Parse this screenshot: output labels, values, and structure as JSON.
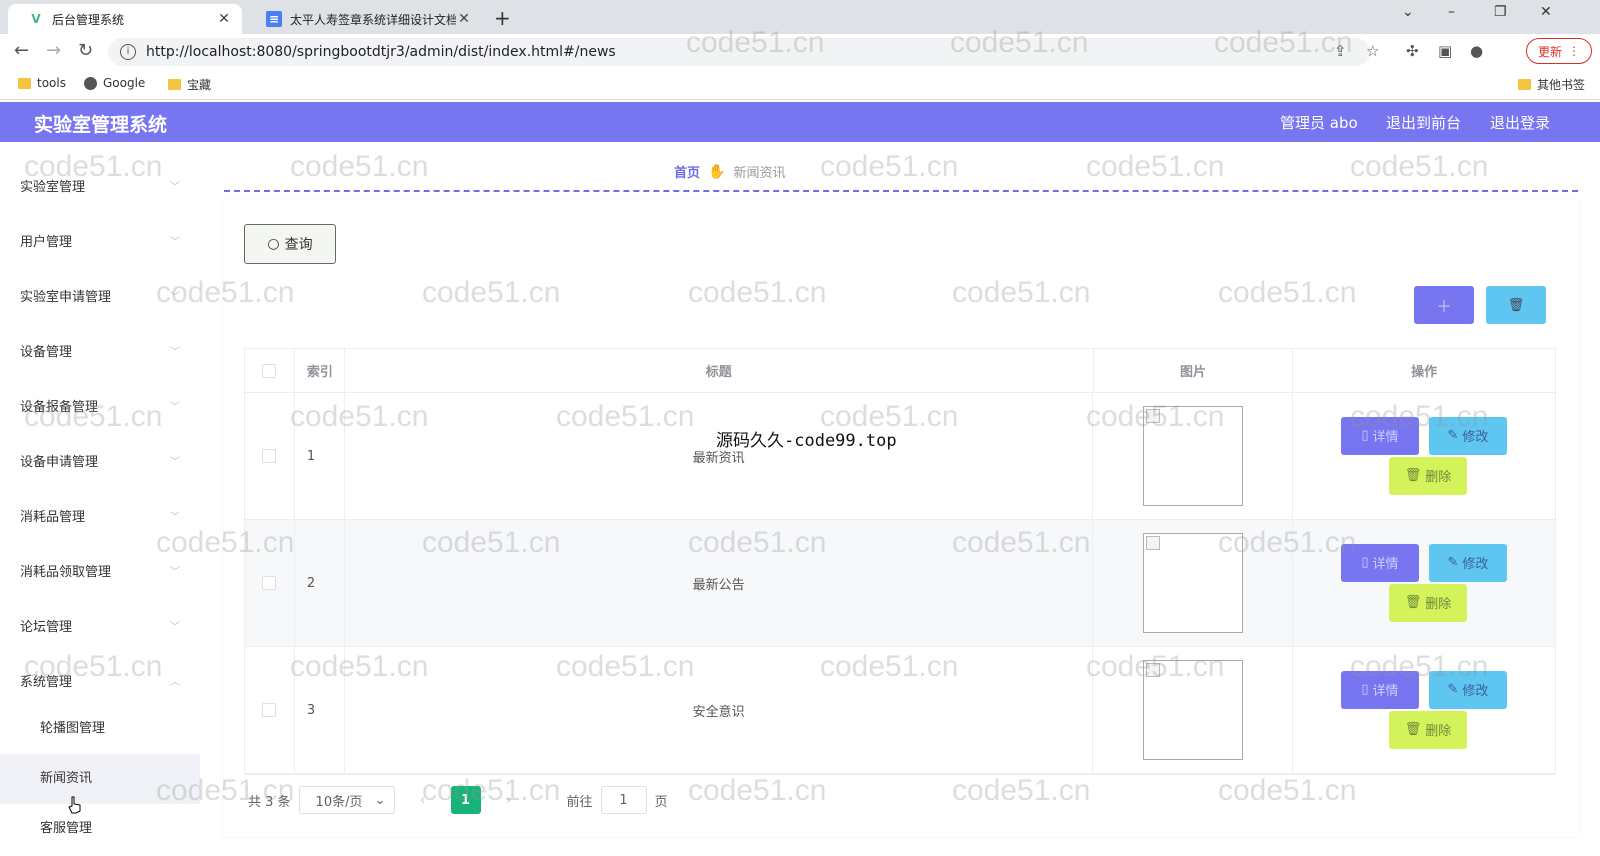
{
  "browser": {
    "tabs": [
      {
        "title": "后台管理系统",
        "active": true,
        "icon": "vue-logo-icon"
      },
      {
        "title": "太平人寿签章系统详细设计文档",
        "active": false,
        "icon": "document-icon"
      }
    ],
    "url": "http://localhost:8080/springbootdtjr3/admin/dist/index.html#/news",
    "update_label": "更新",
    "bookmarks": [
      "tools",
      "Google",
      "宝藏"
    ],
    "other_bookmarks": "其他书签"
  },
  "header": {
    "title": "实验室管理系统",
    "user": "管理员 abo",
    "front_link": "退出到前台",
    "logout": "退出登录"
  },
  "sidebar": {
    "menus": [
      "实验室管理",
      "用户管理",
      "实验室申请管理",
      "设备管理",
      "设备报备管理",
      "设备申请管理",
      "消耗品管理",
      "消耗品领取管理",
      "论坛管理",
      "系统管理"
    ],
    "submenus": [
      "轮播图管理",
      "新闻资讯",
      "客服管理"
    ],
    "active_submenu": "新闻资讯"
  },
  "breadcrumb": {
    "home": "首页",
    "current": "新闻资讯"
  },
  "toolbar": {
    "query_label": "查询",
    "add_icon": "plus-icon",
    "delete_icon": "trash-icon"
  },
  "table": {
    "columns": [
      "索引",
      "标题",
      "图片",
      "操作"
    ],
    "rows": [
      {
        "index": "1",
        "title": "最新资讯"
      },
      {
        "index": "2",
        "title": "最新公告"
      },
      {
        "index": "3",
        "title": "安全意识"
      }
    ],
    "actions": {
      "detail": "详情",
      "edit": "修改",
      "delete": "删除"
    }
  },
  "pagination": {
    "total_text": "共 3 条",
    "page_size": "10条/页",
    "current_page": "1",
    "goto_label": "前往",
    "goto_value": "1",
    "page_unit": "页"
  },
  "overlay_text": "源码久久-code99.top",
  "watermark": "code51.cn",
  "colors": {
    "accent": "#7775f0",
    "info": "#5ec6f0",
    "danger": "#d4f25a",
    "pager_active": "#17b37a"
  }
}
